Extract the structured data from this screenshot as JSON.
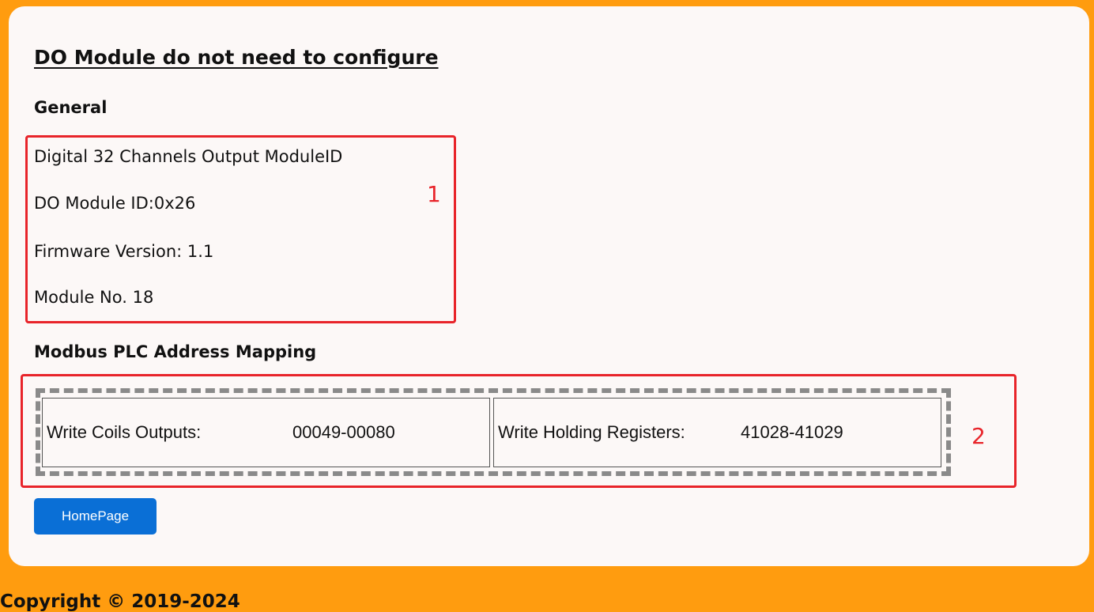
{
  "page": {
    "title": "DO Module do not need to configure"
  },
  "general": {
    "heading": "General",
    "module_description": "Digital 32 Channels Output ModuleID",
    "module_id_label": "DO Module ID:",
    "module_id_value": "0x26",
    "firmware_label": "Firmware Version:",
    "firmware_value": "1.1",
    "module_no_label": "Module No.",
    "module_no_value": "18"
  },
  "modbus": {
    "heading": "Modbus PLC Address Mapping",
    "coils_label": "Write Coils Outputs:",
    "coils_value": "00049-00080",
    "registers_label": "Write Holding Registers:",
    "registers_value": "41028-41029"
  },
  "annotations": {
    "marker_1": "1",
    "marker_2": "2",
    "color": "#e8242a"
  },
  "actions": {
    "homepage_label": "HomePage"
  },
  "footer": {
    "copyright": "Copyright © 2019-2024"
  },
  "colors": {
    "background": "#ff9c0f",
    "card": "#fcf8f7",
    "button": "#0a6fd6"
  }
}
